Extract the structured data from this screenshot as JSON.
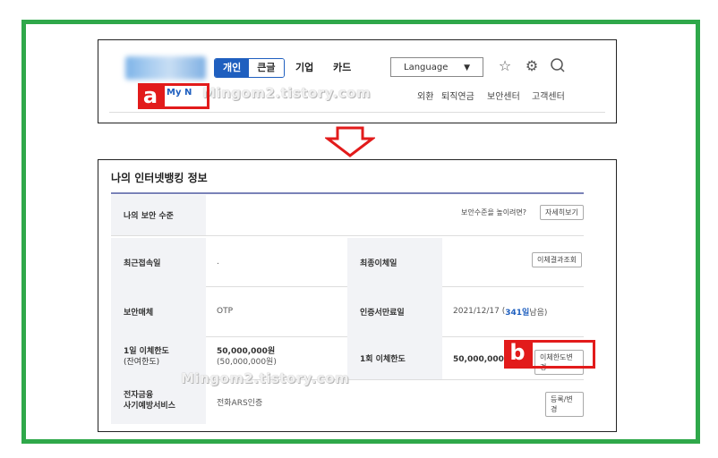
{
  "header": {
    "tabs": [
      {
        "label": "개인"
      },
      {
        "label": "큰글"
      }
    ],
    "nav": [
      "기업",
      "카드"
    ],
    "language": {
      "label": "Language",
      "caret": "▼"
    },
    "icons": [
      "star-icon",
      "gear-icon",
      "search-icon"
    ],
    "my_nw": "My N",
    "sub_nav": [
      "외환",
      "퇴직연금",
      "보안센터",
      "고객센터"
    ]
  },
  "annotations": {
    "a": "a",
    "b": "b",
    "watermark": "Mingom2.tistory.com"
  },
  "info": {
    "title": "나의 인터넷뱅킹 정보",
    "security_level": {
      "label": "나의 보안 수준",
      "hint": "보안수준을 높이려면?",
      "button": "자세히보기"
    },
    "recent_login": {
      "label": "최근접속일",
      "value": "."
    },
    "last_transfer": {
      "label": "최종이체일",
      "button": "이체결과조회"
    },
    "security_medium": {
      "label": "보안매체",
      "value": "OTP"
    },
    "cert_expiry": {
      "label": "인증서만료일",
      "value_prefix": "2021/12/17 ( ",
      "days": "341일",
      "value_suffix": " 남음)"
    },
    "daily_limit": {
      "label": "1일 이체한도",
      "label2": "(잔여한도)",
      "value": "50,000,000원",
      "value2": "(50,000,000원)"
    },
    "once_limit": {
      "label": "1회 이체한도",
      "value": "50,000,000원",
      "button": "이체한도변경"
    },
    "fraud": {
      "label": "전자금융",
      "label2": "사기예방서비스",
      "value": "전화ARS인증",
      "button": "등록/변경"
    }
  },
  "colors": {
    "frame": "#2fa84a",
    "accent": "#1f5fbf",
    "annotation": "#e21b1b"
  }
}
